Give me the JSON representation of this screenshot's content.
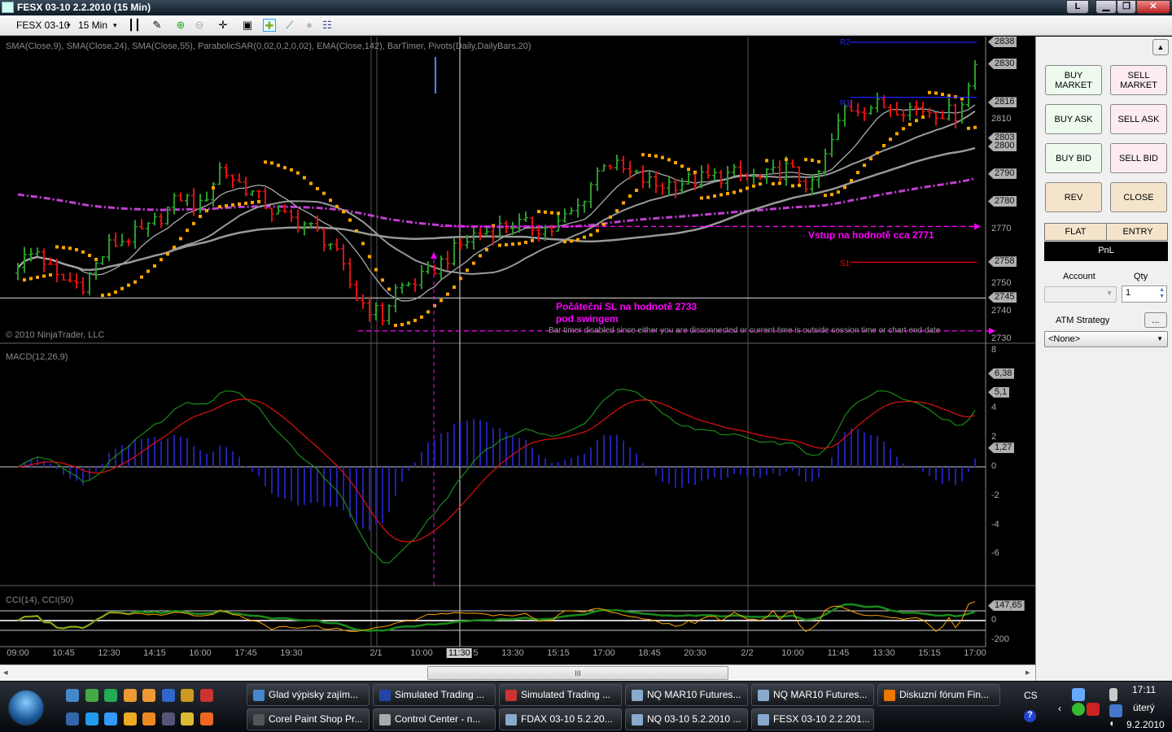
{
  "window": {
    "title": "FESX 03-10  2.2.2010 (15 Min)",
    "extra_btn": "L",
    "min": "▁",
    "max": "❐",
    "close": "✕"
  },
  "toolbar": {
    "instrument": "FESX 03-10",
    "interval": "15 Min",
    "dropdown": "▾"
  },
  "chart": {
    "indicators_label": "SMA(Close,9), SMA(Close,24), SMA(Close,55), ParabolicSAR(0,02,0,2,0,02), EMA(Close,142), BarTimer, Pivots(Daily,DailyBars,20)",
    "copyright": "© 2010 NinjaTrader, LLC",
    "macd_label": "MACD(12,26,9)",
    "cci_label": "CCI(14), CCI(50)",
    "annotation_entry": "Vstup na hodnotě cca 2771",
    "annotation_sl_1": "Počáteční SL na hodnotě 2733",
    "annotation_sl_2": "pod swingem",
    "bartimer_msg": "Bar timer disabled since either you are disconnected or current time is outside session time or chart end date",
    "pivot_r2": "R2",
    "pivot_r1": "R1",
    "pivot_s1": "S1",
    "entry_price": 2771,
    "stop_price": 2733,
    "crosshair_price": 2745,
    "s1_price": 2758,
    "r1_price": 2818,
    "r2_price": 2838,
    "colors": {
      "up": "#2a9a2a",
      "down": "#e01010",
      "sar": "#ffa500",
      "ema": "#c040d0",
      "annot": "#ff00ff",
      "macd": "#1a8a1a",
      "signal": "#e01010",
      "hist": "#2020b0"
    }
  },
  "price_axis": {
    "plain": [
      "2810",
      "2770",
      "2750",
      "2740",
      "2730"
    ],
    "plain_values": [
      2810,
      2770,
      2750,
      2740,
      2730
    ],
    "tags": [
      "2838",
      "2830",
      "2816",
      "2803",
      "2800",
      "2790",
      "2780",
      "2758",
      "2745"
    ],
    "tag_values": [
      2838,
      2830,
      2816,
      2803,
      2800,
      2790,
      2780,
      2758,
      2745
    ]
  },
  "macd_axis": {
    "plain": [
      "8",
      "4",
      "2",
      "0",
      "-2",
      "-4",
      "-6"
    ],
    "plain_values": [
      8,
      4,
      2,
      0,
      -2,
      -4,
      -6
    ],
    "tags": [
      "6,38",
      "5,1",
      "1,27"
    ],
    "tag_values": [
      6.38,
      5.1,
      1.27
    ]
  },
  "cci_axis": {
    "plain": [
      "0",
      "-200"
    ],
    "plain_values": [
      0,
      -200
    ],
    "tags": [
      "147,65"
    ],
    "tag_values": [
      147.65
    ]
  },
  "time_axis": {
    "labels": [
      "09:00",
      "10:45",
      "12:30",
      "14:15",
      "16:00",
      "17:45",
      "19:30",
      "2/1",
      "10:00",
      "11:30",
      "5",
      "13:30",
      "15:15",
      "17:00",
      "18:45",
      "20:30",
      "2/2",
      "10:00",
      "11:45",
      "13:30",
      "15:15",
      "17:00"
    ],
    "bars": [
      0,
      7,
      14,
      21,
      28,
      35,
      42,
      55,
      62,
      67.8,
      70.3,
      76,
      83,
      90,
      97,
      104,
      112,
      119,
      126,
      133,
      140,
      147
    ],
    "highlight_index": 9
  },
  "chart_data": {
    "type": "bar",
    "note": "OHLC 15-min bars, path keypoints [bar, close]",
    "keypoints": [
      [
        0,
        2758
      ],
      [
        3,
        2762
      ],
      [
        6,
        2752
      ],
      [
        10,
        2750
      ],
      [
        14,
        2764
      ],
      [
        20,
        2770
      ],
      [
        25,
        2782
      ],
      [
        28,
        2778
      ],
      [
        31,
        2792
      ],
      [
        35,
        2785
      ],
      [
        40,
        2775
      ],
      [
        44,
        2772
      ],
      [
        48,
        2765
      ],
      [
        52,
        2745
      ],
      [
        56,
        2738
      ],
      [
        58,
        2748
      ],
      [
        62,
        2752
      ],
      [
        66,
        2760
      ],
      [
        70,
        2768
      ],
      [
        76,
        2772
      ],
      [
        82,
        2770
      ],
      [
        86,
        2778
      ],
      [
        90,
        2795
      ],
      [
        94,
        2790
      ],
      [
        98,
        2786
      ],
      [
        104,
        2788
      ],
      [
        110,
        2790
      ],
      [
        114,
        2788
      ],
      [
        118,
        2792
      ],
      [
        122,
        2785
      ],
      [
        124,
        2796
      ],
      [
        127,
        2814
      ],
      [
        132,
        2815
      ],
      [
        138,
        2814
      ],
      [
        144,
        2812
      ],
      [
        146,
        2822
      ],
      [
        147,
        2830
      ]
    ],
    "ema_seed": 2783,
    "ylim": [
      2728,
      2840
    ]
  },
  "panel": {
    "buy_market": "BUY MARKET",
    "sell_market": "SELL MARKET",
    "buy_ask": "BUY ASK",
    "sell_ask": "SELL ASK",
    "buy_bid": "BUY BID",
    "sell_bid": "SELL BID",
    "rev": "REV",
    "close": "CLOSE",
    "flat": "FLAT",
    "entry": "ENTRY",
    "pnl": "PnL",
    "account": "Account",
    "qty": "Qty",
    "qty_value": "1",
    "atm": "ATM Strategy",
    "atm_btn": "...",
    "atm_value": "<None>",
    "scroll_up": "▲"
  },
  "scroll": {
    "thumb": "III",
    "left": "◂",
    "right": "▸"
  },
  "taskbar": {
    "row1": [
      "Glad výpisky zajím...",
      "Simulated Trading ...",
      "Simulated Trading ...",
      "NQ MAR10 Futures...",
      "NQ MAR10 Futures...",
      "Diskuzní fórum Fin..."
    ],
    "row2": [
      "Corel Paint Shop Pr...",
      "Control Center - n...",
      "FDAX 03-10  5.2.20...",
      "NQ 03-10  5.2.2010 ...",
      "FESX 03-10  2.2.201..."
    ],
    "lang": "CS",
    "time": "17:11",
    "day": "úterý",
    "date": "9.2.2010"
  }
}
